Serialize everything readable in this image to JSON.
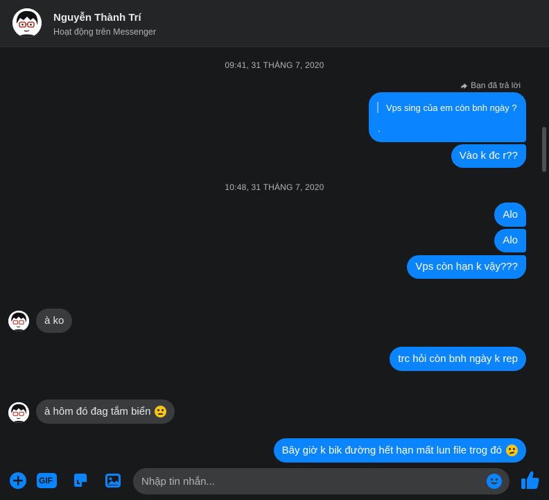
{
  "header": {
    "name": "Nguyễn Thành Trí",
    "status": "Hoạt động trên Messenger"
  },
  "conversation": {
    "timestamp_1": "09:41, 31 THÁNG 7, 2020",
    "reply_note": "Bạn đã trả lời",
    "quoted_text": "Vps sing của em còn bnh ngày ?",
    "quoted_reply": ".",
    "msg_1": "Vào k đc r??",
    "timestamp_2": "10:48, 31 THÁNG 7, 2020",
    "msg_2": "Alo",
    "msg_3": "Alo",
    "msg_4": "Vps còn hạn k vậy???",
    "msg_5": "à ko",
    "msg_6": "trc hỏi còn bnh ngày k rep",
    "msg_7": "à hôm đó đag tắm biển",
    "msg_8": "Bây giờ k bik đường hết hạn mất lun file trog đó"
  },
  "composer": {
    "placeholder": "Nhập tin nhắn...",
    "gif_label": "GIF"
  },
  "colors": {
    "outgoing": "#0a84ff",
    "incoming": "#3a3b3c",
    "background": "#18191a",
    "header": "#242526"
  }
}
